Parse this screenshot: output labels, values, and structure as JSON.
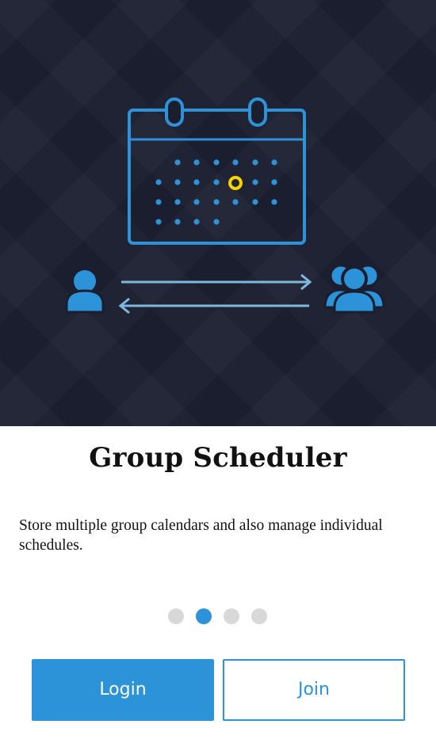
{
  "title": "Group Scheduler",
  "description": "Store multiple group calendars and also manage individual schedules.",
  "pagination": {
    "total": 4,
    "active_index": 1
  },
  "buttons": {
    "login": "Login",
    "join": "Join"
  },
  "colors": {
    "hero_background": "#1a1e2e",
    "accent": "#2d93d9",
    "highlight": "#f5d400",
    "dot_inactive": "#d8d8d8"
  },
  "illustration": {
    "icons": [
      "calendar-icon",
      "person-icon",
      "arrow-right-icon",
      "arrow-left-icon",
      "group-icon"
    ]
  }
}
